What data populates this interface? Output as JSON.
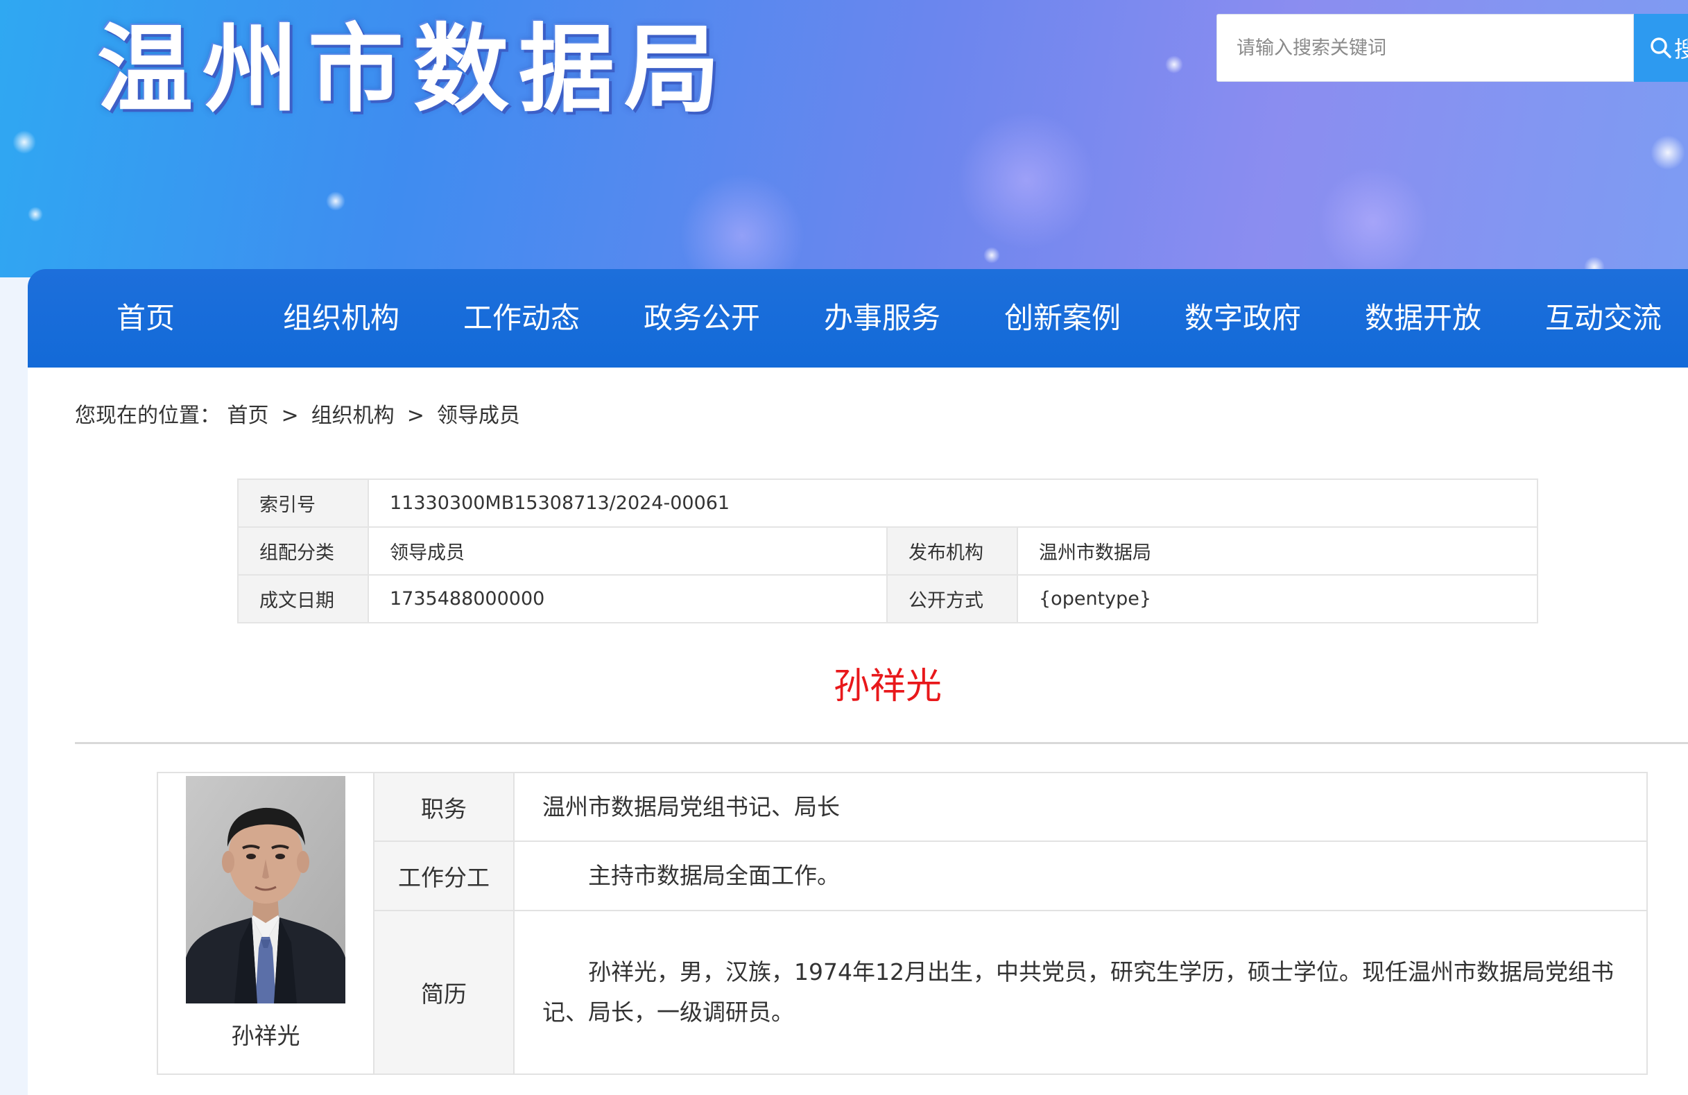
{
  "header": {
    "site_title": "温州市数据局",
    "search_placeholder": "请输入搜索关键词",
    "search_button_label": "搜"
  },
  "nav": {
    "items": [
      "首页",
      "组织机构",
      "工作动态",
      "政务公开",
      "办事服务",
      "创新案例",
      "数字政府",
      "数据开放",
      "互动交流"
    ]
  },
  "breadcrumb": {
    "prefix": "您现在的位置：",
    "items": [
      "首页",
      "组织机构",
      "领导成员"
    ],
    "separator": ">"
  },
  "meta": {
    "index_label": "索引号",
    "index_value": "11330300MB15308713/2024-00061",
    "category_label": "组配分类",
    "category_value": "领导成员",
    "publisher_label": "发布机构",
    "publisher_value": "温州市数据局",
    "date_label": "成文日期",
    "date_value": "1735488000000",
    "open_label": "公开方式",
    "open_value": "{opentype}"
  },
  "person": {
    "title": "孙祥光",
    "photo_caption": "孙祥光",
    "position_label": "职务",
    "position_value": "温州市数据局党组书记、局长",
    "duty_label": "工作分工",
    "duty_value": "主持市数据局全面工作。",
    "bio_label": "简历",
    "bio_value": "孙祥光，男，汉族，1974年12月出生，中共党员，研究生学历，硕士学位。现任温州市数据局党组书记、局长，一级调研员。"
  },
  "colors": {
    "nav_bg": "#136ad8",
    "title_red": "#e8181b",
    "search_btn": "#2d9af0"
  }
}
